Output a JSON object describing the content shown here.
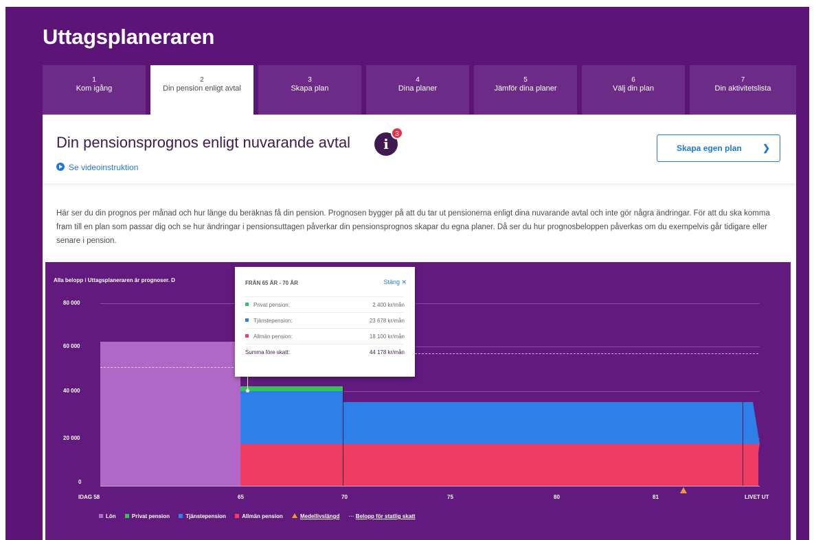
{
  "app": {
    "title": "Uttagsplaneraren"
  },
  "tabs": [
    {
      "num": "1",
      "label": "Kom igång"
    },
    {
      "num": "2",
      "label": "Din pension enligt avtal"
    },
    {
      "num": "3",
      "label": "Skapa plan"
    },
    {
      "num": "4",
      "label": "Dina planer"
    },
    {
      "num": "5",
      "label": "Jämför dina planer"
    },
    {
      "num": "6",
      "label": "Välj din plan"
    },
    {
      "num": "7",
      "label": "Din aktivitetslista"
    }
  ],
  "header": {
    "heading": "Din pensionsprognos enligt nuvarande avtal",
    "info_glyph": "i",
    "info_count": "3",
    "video_link": "Se videoinstruktion",
    "cta": "Skapa egen plan",
    "cta_icon": "chevron-right-icon"
  },
  "intro": "Här ser du din prognos per månad och hur länge du beräknas få din pension. Prognosen bygger på att du tar ut pensionerna enligt dina nuvarande avtal och inte gör några ändringar. För att du ska komma fram till en plan som passar dig och se hur ändringar i pensionsuttagen påverkar din pensionsprognos skapar du egna planer. Då ser du hur prognosbeloppen påverkas om du exempelvis går tidigare eller senare i pension.",
  "chart_note": "Alla belopp i Uttagsplaneraren är prognoser. D",
  "tooltip": {
    "title": "FRÅN 65 ÅR - 70 ÅR",
    "close": "Stäng ✕",
    "rows": [
      {
        "label": "Privat pension:",
        "value": "2 400 kr/mån",
        "color": "#32c35a"
      },
      {
        "label": "Tjänstepension:",
        "value": "23 678 kr/mån",
        "color": "#2f7fe8"
      },
      {
        "label": "Allmän pension:",
        "value": "18 100 kr/mån",
        "color": "#ef3d62"
      }
    ],
    "sum_label": "Summa före skatt:",
    "sum_value": "44 178 kr/mån"
  },
  "legend": {
    "lon": "Lön",
    "privat": "Privat pension",
    "tjanste": "Tjänstepension",
    "allman": "Allmän pension",
    "medel": "Medellivslängd",
    "skatt": "Belopp för statlig skatt"
  },
  "colors": {
    "lon": "#b068c6",
    "privat": "#32c35a",
    "tjanste": "#2f7fe8",
    "allman": "#ef3d62",
    "medel": "#f39a2b",
    "brand": "#5c1476"
  },
  "chart_data": {
    "type": "area",
    "y_ticks": [
      "80 000",
      "60 000",
      "40 000",
      "20 000",
      "0"
    ],
    "ylim": [
      0,
      80000
    ],
    "x_ticks": [
      "IDAG 58",
      "65",
      "70",
      "75",
      "80",
      "81",
      "LIVET UT"
    ],
    "series": [
      {
        "name": "Lön",
        "segments": [
          {
            "from": "IDAG 58",
            "to": "65",
            "value": 62000
          }
        ]
      },
      {
        "name": "Privat pension",
        "segments": [
          {
            "from": "65",
            "to": "70",
            "value": 2400
          }
        ]
      },
      {
        "name": "Tjänstepension",
        "segments": [
          {
            "from": "65",
            "to": "70",
            "value": 23678
          },
          {
            "from": "70",
            "to": "LIVET UT",
            "value": 17500
          }
        ]
      },
      {
        "name": "Allmän pension",
        "segments": [
          {
            "from": "65",
            "to": "LIVET UT",
            "value": 18100
          }
        ]
      }
    ],
    "tax_threshold": 51000,
    "life_expectancy_marker": "between 81 and LIVET UT"
  }
}
